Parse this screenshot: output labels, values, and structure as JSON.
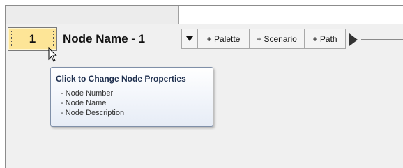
{
  "node": {
    "number": "1",
    "name": "Node Name - 1"
  },
  "toolbar": {
    "palette_label": "+ Palette",
    "scenario_label": "+ Scenario",
    "path_label": "+ Path"
  },
  "tooltip": {
    "title": "Click to Change Node Properties",
    "items": [
      "- Node Number",
      "- Node Name",
      "- Node Description"
    ]
  },
  "colors": {
    "node_number_bg": "#fde597",
    "tooltip_border": "#7f8fa8",
    "tooltip_title": "#1e2f4e"
  },
  "icons": [
    "chevron-down-icon",
    "play-arrow-icon",
    "mouse-pointer-icon"
  ]
}
